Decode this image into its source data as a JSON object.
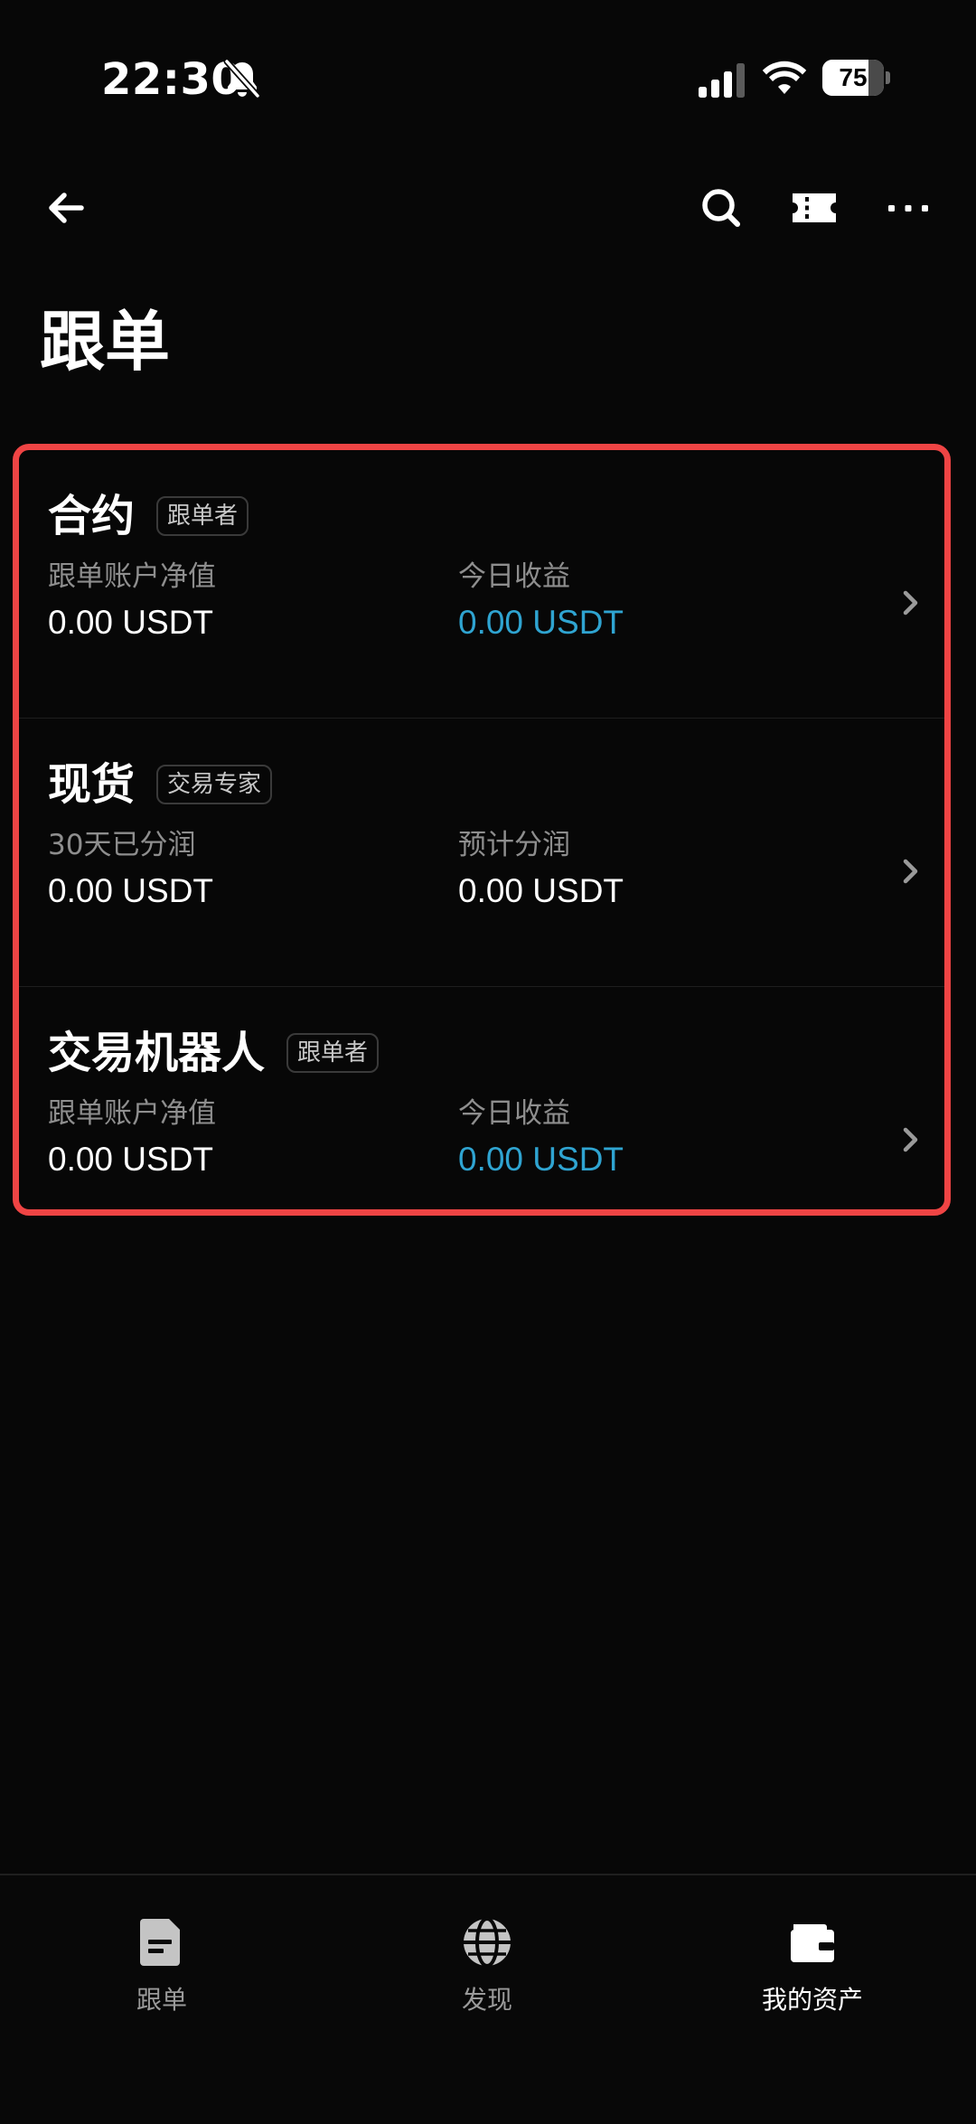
{
  "status_bar": {
    "time": "22:30",
    "battery": "75",
    "battery_level": 0.75,
    "icons": [
      "bell-off-icon",
      "signal-icon",
      "wifi-icon",
      "battery-icon"
    ]
  },
  "nav": {
    "icons": [
      "back-arrow-icon",
      "search-icon",
      "ticket-icon",
      "more-icon"
    ]
  },
  "page": {
    "title": "跟单"
  },
  "colors": {
    "accent": "#2fa4d1",
    "highlight_border": "#ef4444",
    "background": "#070707"
  },
  "cards": [
    {
      "title": "合约",
      "tag": "跟单者",
      "left_label": "跟单账户净值",
      "left_value": "0.00 USDT",
      "right_label": "今日收益",
      "right_value": "0.00 USDT",
      "right_accent": true
    },
    {
      "title": "现货",
      "tag": "交易专家",
      "left_label": "30天已分润",
      "left_value": "0.00 USDT",
      "right_label": "预计分润",
      "right_value": "0.00 USDT",
      "right_accent": false
    },
    {
      "title": "交易机器人",
      "tag": "跟单者",
      "left_label": "跟单账户净值",
      "left_value": "0.00 USDT",
      "right_label": "今日收益",
      "right_value": "0.00 USDT",
      "right_accent": true
    }
  ],
  "tabs": [
    {
      "label": "跟单",
      "icon": "document-icon",
      "active": false
    },
    {
      "label": "发现",
      "icon": "globe-icon",
      "active": false
    },
    {
      "label": "我的资产",
      "icon": "wallet-icon",
      "active": true
    }
  ]
}
